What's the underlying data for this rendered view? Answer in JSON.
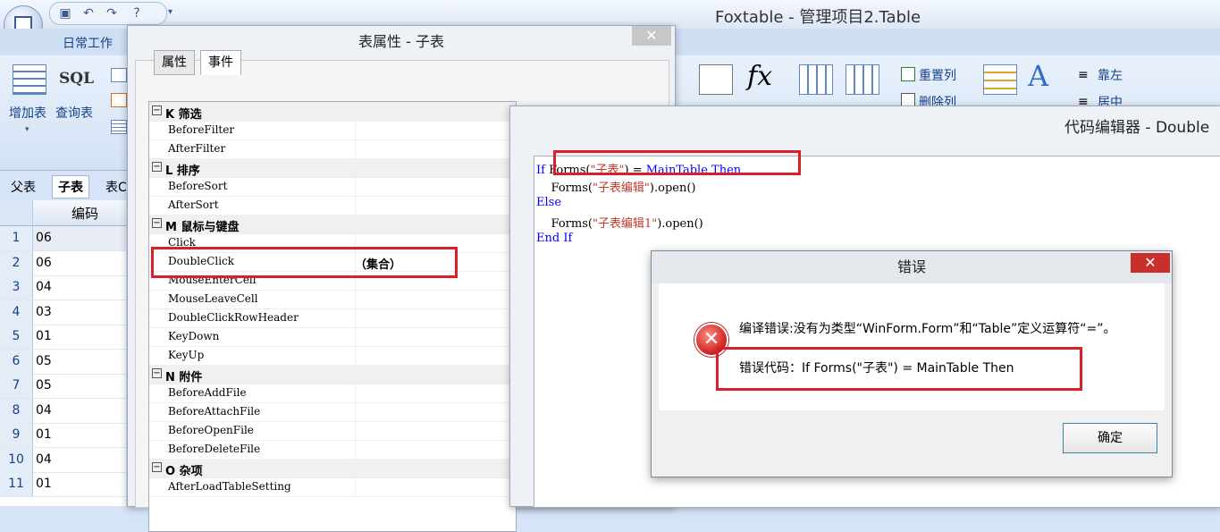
{
  "app": {
    "title": "Foxtable - 管理项目2.Table",
    "tab_daily": "日常工作"
  },
  "ribbon": {
    "add_table": "增加表",
    "sql_label": "SQL",
    "query_table": "查询表",
    "reset_column": "重置列",
    "delete_column": "删除列",
    "align_left": "靠左",
    "align_center": "居中",
    "fx_label": "fx"
  },
  "sheet_tabs": [
    "父表",
    "子表",
    "表C"
  ],
  "grid": {
    "column_header": "编码",
    "rows": [
      {
        "n": "1",
        "v": "06"
      },
      {
        "n": "2",
        "v": "06"
      },
      {
        "n": "3",
        "v": "04"
      },
      {
        "n": "4",
        "v": "03"
      },
      {
        "n": "5",
        "v": "01"
      },
      {
        "n": "6",
        "v": "05"
      },
      {
        "n": "7",
        "v": "05"
      },
      {
        "n": "8",
        "v": "04"
      },
      {
        "n": "9",
        "v": "01"
      },
      {
        "n": "10",
        "v": "04"
      },
      {
        "n": "11",
        "v": "01"
      }
    ]
  },
  "props_dialog": {
    "title": "表属性 - 子表",
    "close": "✕",
    "tabs": [
      "属性",
      "事件"
    ],
    "rows": [
      {
        "kind": "group",
        "label": "K 筛选"
      },
      {
        "kind": "item",
        "label": "BeforeFilter"
      },
      {
        "kind": "item",
        "label": "AfterFilter"
      },
      {
        "kind": "group",
        "label": "L 排序"
      },
      {
        "kind": "item",
        "label": "BeforeSort"
      },
      {
        "kind": "item",
        "label": "AfterSort"
      },
      {
        "kind": "group",
        "label": "M 鼠标与键盘"
      },
      {
        "kind": "item",
        "label": "Click"
      },
      {
        "kind": "item",
        "label": "DoubleClick",
        "value": "（集合）"
      },
      {
        "kind": "item",
        "label": "MouseEnterCell"
      },
      {
        "kind": "item",
        "label": "MouseLeaveCell"
      },
      {
        "kind": "item",
        "label": "DoubleClickRowHeader"
      },
      {
        "kind": "item",
        "label": "KeyDown"
      },
      {
        "kind": "item",
        "label": "KeyUp"
      },
      {
        "kind": "group",
        "label": "N 附件"
      },
      {
        "kind": "item",
        "label": "BeforeAddFile"
      },
      {
        "kind": "item",
        "label": "BeforeAttachFile"
      },
      {
        "kind": "item",
        "label": "BeforeOpenFile"
      },
      {
        "kind": "item",
        "label": "BeforeDeleteFile"
      },
      {
        "kind": "group",
        "label": "O 杂项"
      },
      {
        "kind": "item",
        "label": "AfterLoadTableSetting"
      }
    ]
  },
  "code_editor": {
    "title": "代码编辑器 - Double",
    "line1": {
      "kw1": "If",
      "t1": " Forms(",
      "s1": "\"子表\"",
      "t2": ") = ",
      "kw2": "MainTable Then"
    },
    "line2": {
      "t1": "    Forms(",
      "s1": "\"子表编辑\"",
      "t2": ").open()"
    },
    "line3": "Else",
    "line4": {
      "t1": "    Forms(",
      "s1": "\"子表编辑1\"",
      "t2": ").open()"
    },
    "line5": "End If"
  },
  "error_dialog": {
    "title": "错误",
    "close": "✕",
    "message": "编译错误:没有为类型“WinForm.Form”和“Table”定义运算符“=”。",
    "code_line": "错误代码：If  Forms(\"子表\") = MainTable Then",
    "ok": "确定"
  },
  "colors": {
    "highlight": "#d9202a",
    "keyword": "#0000ff",
    "string": "#c0392b"
  }
}
